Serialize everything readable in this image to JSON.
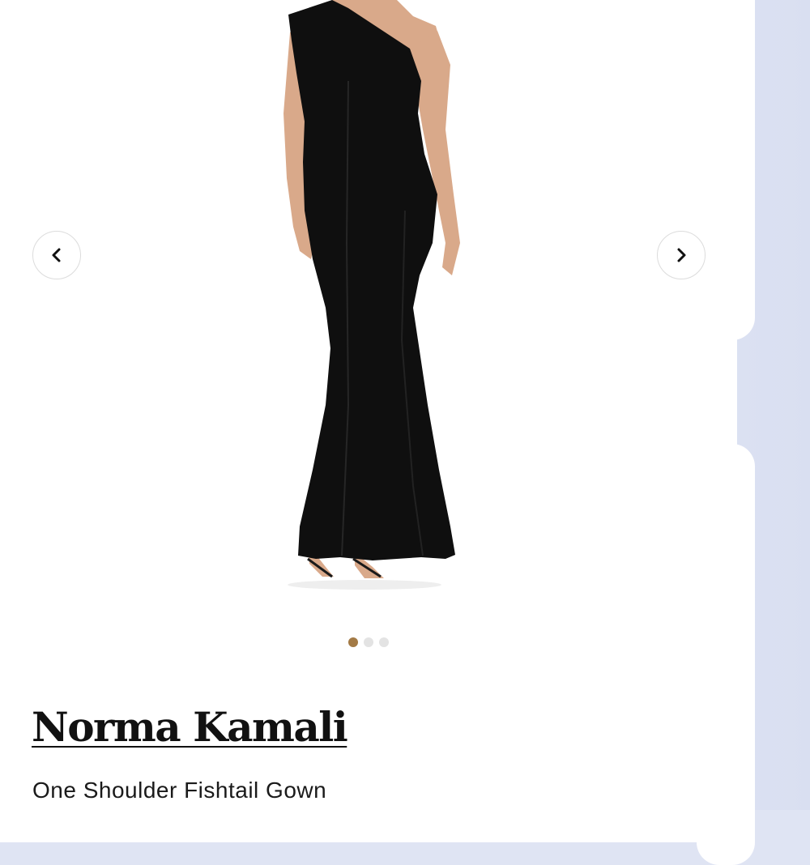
{
  "product": {
    "brand": "Norma Kamali",
    "name": "One Shoulder Fishtail Gown",
    "image_subject": "black-one-shoulder-fishtail-gown"
  },
  "carousel": {
    "slide_count": 3,
    "active_index": 0,
    "prev_icon": "chevron-left-icon",
    "next_icon": "chevron-right-icon"
  },
  "colors": {
    "active_dot": "#a37a45",
    "inactive_dot": "#e3e3e3",
    "backdrop": "#dfe4f3"
  }
}
